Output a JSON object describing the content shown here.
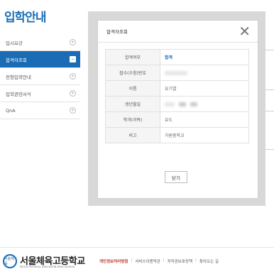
{
  "page": {
    "title": "입학안내"
  },
  "sidebar": {
    "items": [
      {
        "label": "입시요강",
        "active": false
      },
      {
        "label": "합격자조회",
        "active": true
      },
      {
        "label": "전형입학안내",
        "active": false
      },
      {
        "label": "입학관련서식",
        "active": false
      },
      {
        "label": "QnA",
        "active": false
      }
    ]
  },
  "modal": {
    "title": "합격자조회",
    "close_glyph": "✕",
    "rows": [
      {
        "label": "합격여부",
        "value": "합격"
      },
      {
        "label": "접수(수험)번호",
        "value": ""
      },
      {
        "label": "이름",
        "value": "유기열"
      },
      {
        "label": "생년월일",
        "value": ""
      },
      {
        "label": "학과(과목)",
        "value": "유도"
      },
      {
        "label": "비고",
        "value": "가원중학교"
      }
    ],
    "button_label": "닫기"
  },
  "footer": {
    "logo_emblem": "서울체육",
    "logo_text": "서울체육고등학교",
    "logo_sub": "SEOUL PHYSICAL EDUCATION HIGH SCHOOL",
    "links": [
      "개인정보처리방침",
      "서비스이용약관",
      "저작권보호정책",
      "찾아오는 길"
    ]
  },
  "colors": {
    "accent": "#1a6cb5",
    "overlay": "#d8d8d8",
    "privacy_link": "#c0392b"
  }
}
